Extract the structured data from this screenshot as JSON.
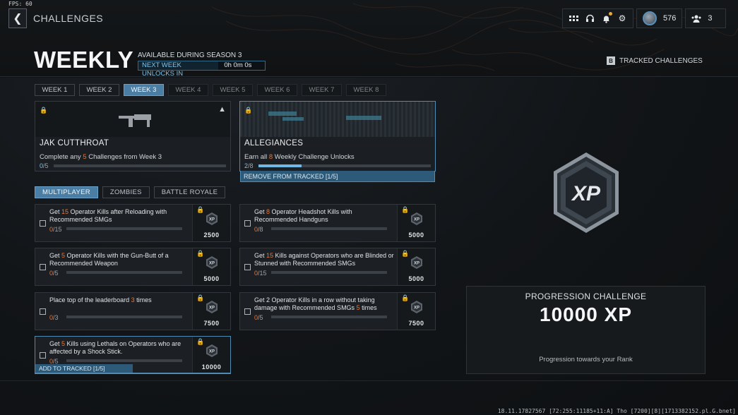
{
  "fps": "FPS: 60",
  "header": {
    "breadcrumb": "CHALLENGES",
    "hud": {
      "rank_level": "576",
      "party_count": "3"
    }
  },
  "title": "WEEKLY",
  "availability": "AVAILABLE DURING SEASON 3",
  "unlock_label": "NEXT WEEK UNLOCKS IN",
  "unlock_timer": "0h 0m 0s",
  "tracked_challenges": {
    "key": "B",
    "label": "TRACKED CHALLENGES"
  },
  "weeks": [
    "WEEK 1",
    "WEEK 2",
    "WEEK 3",
    "WEEK 4",
    "WEEK 5",
    "WEEK 6",
    "WEEK 7",
    "WEEK 8"
  ],
  "active_week": "WEEK 3",
  "rewards": [
    {
      "name": "JAK CUTTHROAT",
      "desc_pre": "Complete any ",
      "desc_num": "5",
      "desc_post": " Challenges from Week 3",
      "progress_cur": "0",
      "progress_total": "/5",
      "fraction": 0
    },
    {
      "name": "ALLEGIANCES",
      "desc_pre": "Earn all ",
      "desc_num": "8",
      "desc_post": " Weekly Challenge Unlocks",
      "progress_cur": "2",
      "progress_total": "/8",
      "fraction": 0.25,
      "tracked_label": "REMOVE FROM TRACKED [1/5]"
    }
  ],
  "modes": [
    "MULTIPLAYER",
    "ZOMBIES",
    "BATTLE ROYALE"
  ],
  "challenges": [
    {
      "pre": "Get ",
      "num": "15",
      "post": " Operator Kills after Reloading with Recommended SMGs",
      "cur": "0",
      "total": "/15",
      "xp": "2500"
    },
    {
      "pre": "Get ",
      "num": "8",
      "post": " Operator Headshot Kills with Recommended Handguns",
      "cur": "0",
      "total": "/8",
      "xp": "5000"
    },
    {
      "pre": "Get ",
      "num": "5",
      "post": " Operator Kills with the Gun-Butt of a Recommended Weapon",
      "cur": "0",
      "total": "/5",
      "xp": "5000"
    },
    {
      "pre": "Get ",
      "num": "15",
      "post": " Kills against Operators who are Blinded or Stunned with Recommended SMGs",
      "cur": "0",
      "total": "/15",
      "xp": "5000"
    },
    {
      "pre": "Place top of the leaderboard ",
      "num": "3",
      "post": " times",
      "cur": "0",
      "total": "/3",
      "xp": "7500"
    },
    {
      "pre": "Get 2 Operator Kills in a row without taking damage with Recommended SMGs ",
      "num": "5",
      "post": " times",
      "cur": "0",
      "total": "/5",
      "xp": "7500"
    },
    {
      "pre": "Get ",
      "num": "5",
      "post": " Kills using Lethals on Operators who are affected by a Shock Stick.",
      "cur": "0",
      "total": "/5",
      "xp": "10000",
      "tracked_label": "ADD TO TRACKED [1/5]"
    }
  ],
  "progression": {
    "title": "PROGRESSION CHALLENGE",
    "value": "10000 XP",
    "subtitle": "Progression towards your Rank"
  },
  "build_string": "18.11.17827567 [72:255:11185+11:A] Tho [7200][8][1713382152.pl.G.bnet]"
}
